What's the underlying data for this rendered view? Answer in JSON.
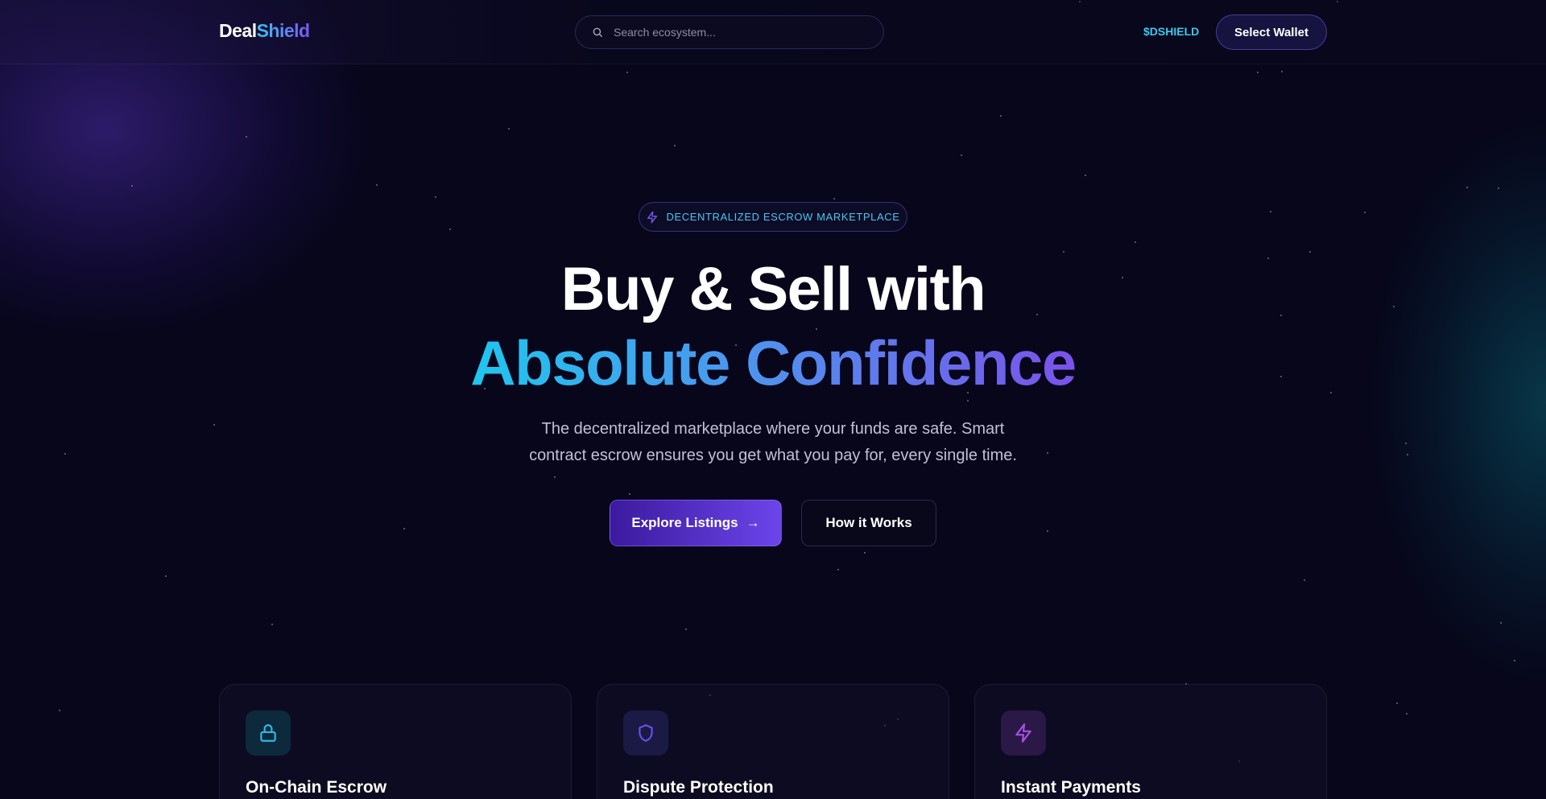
{
  "header": {
    "logo_part1": "Deal",
    "logo_part2": "Shield",
    "search_placeholder": "Search ecosystem...",
    "token_label": "$DSHIELD",
    "wallet_button": "Select Wallet"
  },
  "hero": {
    "badge": "DECENTRALIZED ESCROW MARKETPLACE",
    "title_line1": "Buy & Sell with",
    "title_line2": "Absolute Confidence",
    "subtitle_line1": "The decentralized marketplace where your funds are safe. Smart",
    "subtitle_line2": "contract escrow ensures you get what you pay for, every single time.",
    "primary_button": "Explore Listings",
    "primary_button_arrow": "→",
    "secondary_button": "How it Works"
  },
  "features": [
    {
      "title": "On-Chain Escrow",
      "icon": "lock-icon",
      "color": "#2fb8e0"
    },
    {
      "title": "Dispute Protection",
      "icon": "shield-icon",
      "color": "#6a4fe6"
    },
    {
      "title": "Instant Payments",
      "icon": "lightning-icon",
      "color": "#a64ee6"
    }
  ],
  "colors": {
    "accent_cyan": "#3cc8ee",
    "accent_purple": "#6c45ea",
    "background": "#07061a"
  }
}
